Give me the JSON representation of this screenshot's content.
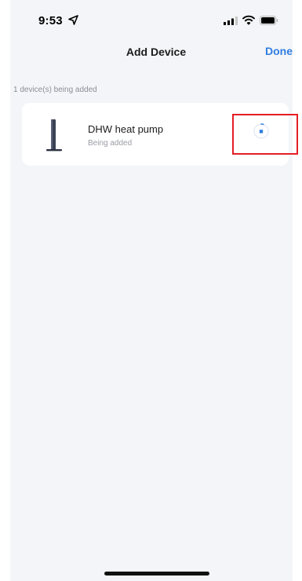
{
  "status_bar": {
    "time": "9:53",
    "icons": [
      "location-arrow-icon",
      "cellular-signal-icon",
      "wifi-icon",
      "battery-icon"
    ]
  },
  "nav": {
    "title": "Add Device",
    "done_label": "Done"
  },
  "section": {
    "label": "1 device(s) being added"
  },
  "devices": [
    {
      "name": "DHW heat pump",
      "status": "Being added",
      "icon": "heat-pump-device-icon",
      "progress_icon": "loading-spinner-icon"
    }
  ],
  "colors": {
    "accent": "#2f7de1",
    "background": "#f4f5f8",
    "card": "#ffffff",
    "highlight": "#e41e26"
  }
}
